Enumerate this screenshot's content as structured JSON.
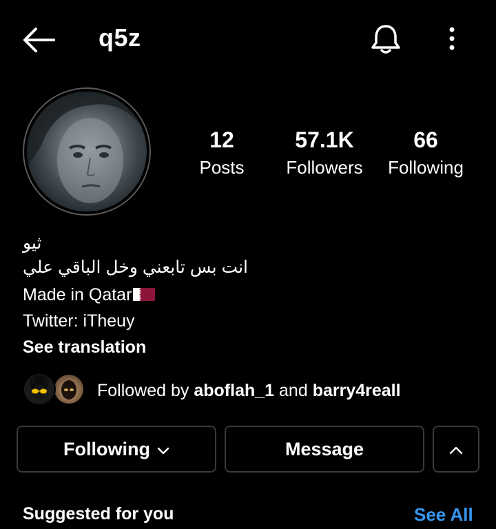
{
  "header": {
    "title": "q5z",
    "icons": [
      "back-arrow-icon",
      "bell-icon",
      "more-vertical-icon"
    ]
  },
  "stats": {
    "posts": {
      "value": "12",
      "label": "Posts"
    },
    "followers": {
      "value": "57.1K",
      "label": "Followers"
    },
    "following": {
      "value": "66",
      "label": "Following"
    }
  },
  "bio": {
    "name": "ثيو",
    "line1": "انت بس تابعني وخل الباقي علي",
    "line2": "Made in Qatar",
    "line3": "Twitter: iTheuy",
    "translate": "See translation"
  },
  "followed_by": {
    "prefix": "Followed by",
    "user1": "aboflah_1",
    "conjunction": "and",
    "user2": "barry4reall"
  },
  "actions": {
    "following_label": "Following",
    "message_label": "Message"
  },
  "suggested": {
    "title": "Suggested for you",
    "see_all": "See All"
  },
  "colors": {
    "background": "#000000",
    "text": "#ffffff",
    "link": "#3797f0",
    "border": "#3a3a3a",
    "qatar_maroon": "#8a1538"
  }
}
